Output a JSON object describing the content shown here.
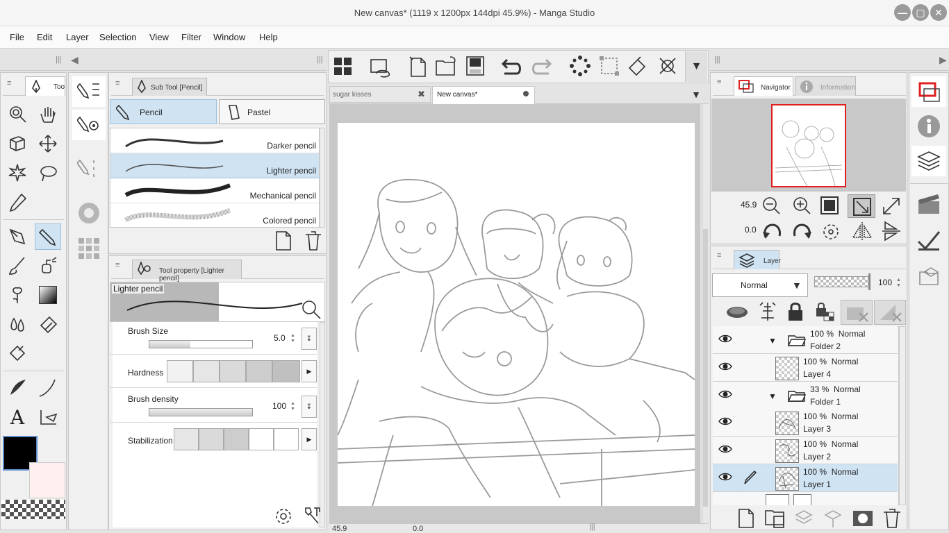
{
  "window": {
    "title": "New canvas* (1119 x 1200px 144dpi 45.9%)  - Manga Studio",
    "minimize_icon": "minimize-icon",
    "maximize_icon": "maximize-icon",
    "close_icon": "close-icon"
  },
  "menu": [
    "File",
    "Edit",
    "Layer",
    "Selection",
    "View",
    "Filter",
    "Window",
    "Help"
  ],
  "tool_palette": {
    "tab_label": "Too"
  },
  "subtool": {
    "tab_label": "Sub Tool [Pencil]",
    "groups": [
      "Pencil",
      "Pastel"
    ],
    "items": [
      "Darker pencil",
      "Lighter pencil",
      "Mechanical pencil",
      "Colored pencil"
    ],
    "selected": "Lighter pencil"
  },
  "tool_property": {
    "tab_label": "Tool property [Lighter pencil]",
    "preview_name": "Lighter pencil",
    "brush_size_label": "Brush Size",
    "brush_size_value": "5.0",
    "brush_size_fraction": 0.4,
    "hardness_label": "Hardness",
    "hardness_level": 5,
    "density_label": "Brush density",
    "density_value": "100",
    "stabilization_label": "Stabilization",
    "stabilization_level": 3
  },
  "canvas_tabs": [
    {
      "label": "sugar kisses"
    },
    {
      "label": "New canvas*"
    }
  ],
  "status": {
    "zoom": "45.9",
    "angle": "0.0"
  },
  "navigator": {
    "tab_label": "Navigator",
    "info_tab_label": "Information",
    "zoom": "45.9",
    "rotation": "0.0"
  },
  "layer_panel": {
    "tab_label": "Layer",
    "blend_mode": "Normal",
    "opacity": "100",
    "layers": [
      {
        "pct": "100 %",
        "mode": "Normal",
        "name": "Folder 2",
        "folder": true
      },
      {
        "pct": "100 %",
        "mode": "Normal",
        "name": "Layer 4",
        "folder": false
      },
      {
        "pct": "33 %",
        "mode": "Normal",
        "name": "Folder 1",
        "folder": true
      },
      {
        "pct": "100 %",
        "mode": "Normal",
        "name": "Layer 3",
        "folder": false
      },
      {
        "pct": "100 %",
        "mode": "Normal",
        "name": "Layer 2",
        "folder": false
      },
      {
        "pct": "100 %",
        "mode": "Normal",
        "name": "Layer 1",
        "folder": false,
        "selected": true
      }
    ]
  },
  "colors": {
    "accent": "#cfe3f3",
    "main_color": "#000000",
    "sub_color": "#fff0f0",
    "nav_frame": "#e02020"
  }
}
